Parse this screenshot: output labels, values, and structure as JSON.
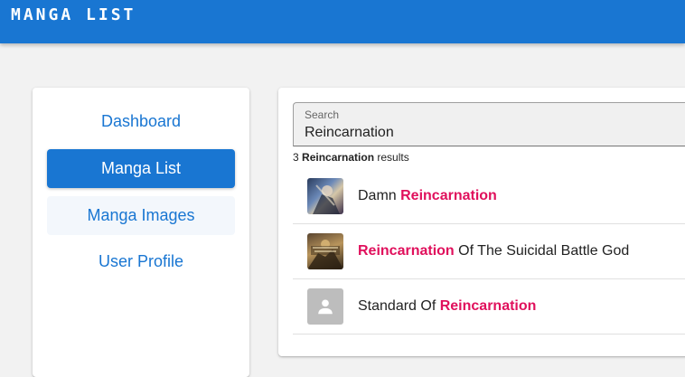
{
  "app": {
    "title": "MANGA LIST"
  },
  "sidebar": {
    "items": [
      {
        "label": "Dashboard",
        "state": "normal"
      },
      {
        "label": "Manga List",
        "state": "active"
      },
      {
        "label": "Manga Images",
        "state": "hover"
      },
      {
        "label": "User Profile",
        "state": "normal"
      }
    ]
  },
  "search": {
    "label": "Search",
    "value": "Reincarnation"
  },
  "results": {
    "count": "3",
    "term": "Reincarnation",
    "suffix": "results",
    "items": [
      {
        "before": "Damn ",
        "highlight": "Reincarnation",
        "after": "",
        "thumb": "cover-image"
      },
      {
        "before": "",
        "highlight": "Reincarnation",
        "after": " Of The Suicidal Battle God",
        "thumb": "cover-image"
      },
      {
        "before": "Standard Of ",
        "highlight": "Reincarnation",
        "after": "",
        "thumb": "placeholder-person-icon"
      }
    ]
  },
  "colors": {
    "primary": "#1976d2",
    "highlight": "#e0105c",
    "background": "#f2f2f2"
  }
}
